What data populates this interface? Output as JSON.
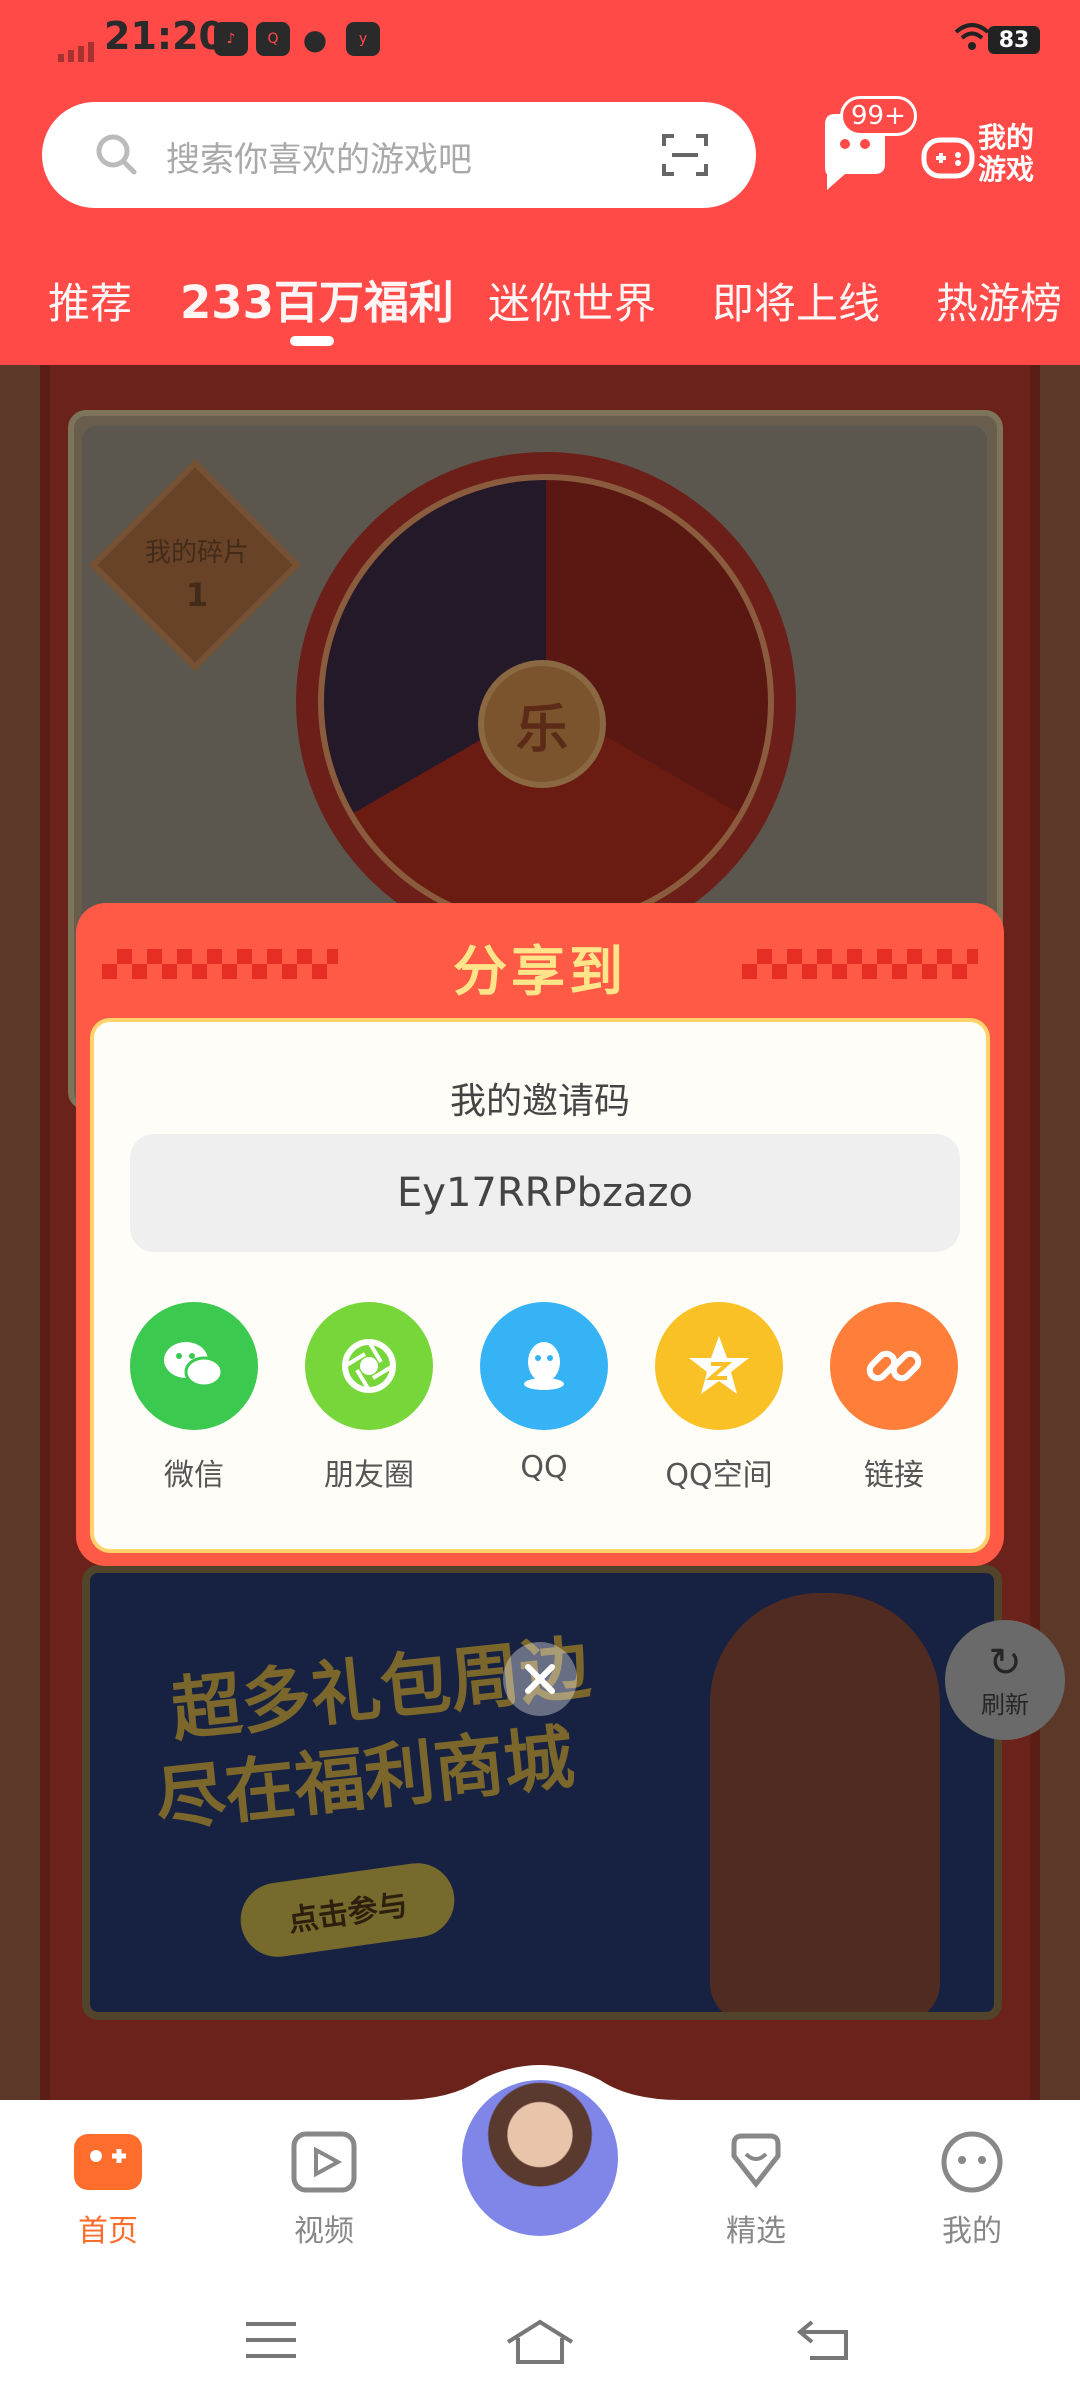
{
  "status_bar": {
    "time": "21:20",
    "battery": "83"
  },
  "search": {
    "placeholder": "搜索你喜欢的游戏吧"
  },
  "header": {
    "badge": "99+",
    "my_games_label": "我的游戏"
  },
  "tabs": [
    {
      "label": "推荐"
    },
    {
      "label": "233百万福利",
      "active": true
    },
    {
      "label": "迷你世界"
    },
    {
      "label": "即将上线"
    },
    {
      "label": "热游榜"
    }
  ],
  "background": {
    "wheel_center": "乐",
    "shard_title": "我的碎片",
    "shard_count": "1",
    "banner_line1": "超多礼包周边",
    "banner_line2": "尽在福利商城",
    "banner_cta": "点击参与",
    "refresh_label": "刷新"
  },
  "share_modal": {
    "title": "分享到",
    "invite_label": "我的邀请码",
    "invite_code": "Ey17RRPbzazo",
    "options": [
      {
        "label": "微信",
        "color": "#3bc94f",
        "icon": "wechat-icon"
      },
      {
        "label": "朋友圈",
        "color": "#77d63a",
        "icon": "moments-icon"
      },
      {
        "label": "QQ",
        "color": "#36b3f5",
        "icon": "qq-icon"
      },
      {
        "label": "QQ空间",
        "color": "#f9c126",
        "icon": "qzone-icon"
      },
      {
        "label": "链接",
        "color": "#ff7e3a",
        "icon": "link-icon"
      }
    ]
  },
  "bottom_nav": [
    {
      "label": "首页",
      "active": true
    },
    {
      "label": "视频"
    },
    {
      "label": "精选"
    },
    {
      "label": "我的"
    }
  ],
  "colors": {
    "brand_red": "#ff4a48",
    "active_orange": "#ff6d2c"
  }
}
